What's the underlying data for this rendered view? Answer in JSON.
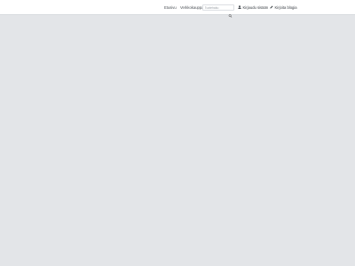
{
  "header": {
    "nav": [
      {
        "label": "Etusivu"
      },
      {
        "label": "Verkkokauppa"
      }
    ],
    "search": {
      "placeholder": "Tuotehaku",
      "value": "",
      "icon": "search-icon"
    },
    "actions": [
      {
        "label": "Kirjaudu sisään",
        "icon": "user-icon"
      },
      {
        "label": "Kirjoita blogia",
        "icon": "pencil-icon"
      }
    ]
  },
  "colors": {
    "background": "#e3e5e8",
    "header_background": "#ffffff",
    "text": "#4a4f55"
  }
}
